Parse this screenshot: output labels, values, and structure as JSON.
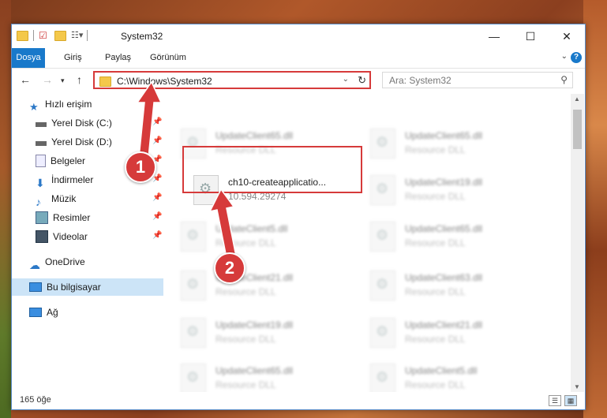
{
  "window": {
    "title": "System32",
    "minimize_label": "—",
    "maximize_label": "☐",
    "close_label": "✕"
  },
  "ribbon": {
    "tabs": [
      "Dosya",
      "Giriş",
      "Paylaş",
      "Görünüm"
    ],
    "help_label": "?"
  },
  "address": {
    "path": "C:\\Windows\\System32",
    "search_placeholder": "Ara: System32"
  },
  "nav": {
    "quick_access": "Hızlı erişim",
    "items": [
      {
        "label": "Yerel Disk (C:)",
        "icon": "drive-icon",
        "pinned": true
      },
      {
        "label": "Yerel Disk (D:)",
        "icon": "drive-icon",
        "pinned": true
      },
      {
        "label": "Belgeler",
        "icon": "documents-icon",
        "pinned": true
      },
      {
        "label": "İndirmeler",
        "icon": "downloads-icon",
        "pinned": true
      },
      {
        "label": "Müzik",
        "icon": "music-icon",
        "pinned": true
      },
      {
        "label": "Resimler",
        "icon": "pictures-icon",
        "pinned": true
      },
      {
        "label": "Videolar",
        "icon": "videos-icon",
        "pinned": true
      }
    ],
    "onedrive": "OneDrive",
    "this_pc": "Bu bilgisayar",
    "network": "Ağ"
  },
  "files": {
    "highlighted": {
      "name": "ch10-createapplicatio...",
      "detail": "10.594.29274"
    },
    "column_left": [
      {
        "name": "UpdateClient65.dll",
        "detail": "Resource DLL"
      },
      {
        "name": "",
        "detail": ""
      },
      {
        "name": "UpdateClient5.dll",
        "detail": "Resource DLL"
      },
      {
        "name": "UpdateClient21.dll",
        "detail": "Resource DLL"
      },
      {
        "name": "UpdateClient19.dll",
        "detail": "Resource DLL"
      },
      {
        "name": "UpdateClient65.dll",
        "detail": "Resource DLL"
      }
    ],
    "column_right": [
      {
        "name": "UpdateClient65.dll",
        "detail": "Resource DLL"
      },
      {
        "name": "UpdateClient19.dll",
        "detail": "Resource DLL"
      },
      {
        "name": "UpdateClient65.dll",
        "detail": "Resource DLL"
      },
      {
        "name": "UpdateClient63.dll",
        "detail": "Resource DLL"
      },
      {
        "name": "UpdateClient21.dll",
        "detail": "Resource DLL"
      },
      {
        "name": "UpdateClient5.dll",
        "detail": "Resource DLL"
      }
    ]
  },
  "status": {
    "item_count": "165 öğe"
  },
  "annotations": {
    "step1": "1",
    "step2": "2",
    "color": "#d63a3a"
  }
}
